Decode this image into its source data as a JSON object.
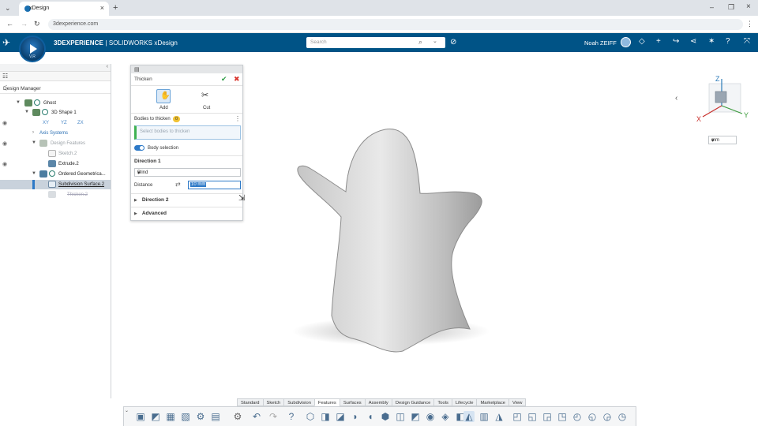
{
  "browser": {
    "tab_title": "xDesign",
    "url": "3dexperience.com"
  },
  "app": {
    "brand_bold": "3DEXPERIENCE",
    "brand_rest": " | SOLIDWORKS xDesign",
    "compass_version": "V,R",
    "search_placeholder": "Search",
    "user_name": "Noah ZEIFF"
  },
  "design_manager": {
    "title": "Design Manager",
    "tree": [
      {
        "label": "Ghost"
      },
      {
        "label": "3D Shape 1"
      },
      {
        "label": "XY",
        "label2": "YZ",
        "label3": "ZX"
      },
      {
        "label": "Axis Systems"
      },
      {
        "label": "Design Features"
      },
      {
        "label": "Sketch.2"
      },
      {
        "label": "Extrude.2"
      },
      {
        "label": "Ordered Geometrica..."
      },
      {
        "label": "Subdivision Surface.2"
      },
      {
        "label": "Thicken.2"
      }
    ]
  },
  "thicken": {
    "title": "Thicken",
    "add_label": "Add",
    "cut_label": "Cut",
    "bodies_label": "Bodies to thicken",
    "bodies_count": "0",
    "bodies_placeholder": "Select bodies to thicken",
    "body_selection_label": "Body selection",
    "direction1_label": "Direction 1",
    "end_condition": "Blind",
    "distance_label": "Distance",
    "distance_value": "10 mm",
    "direction2_label": "Direction 2",
    "advanced_label": "Advanced"
  },
  "viewport": {
    "units": "mm",
    "axis_x": "X",
    "axis_y": "Y",
    "axis_z": "Z"
  },
  "command_tabs": [
    "Standard",
    "Sketch",
    "Subdivision",
    "Features",
    "Surfaces",
    "Assembly",
    "Design Guidance",
    "Tools",
    "Lifecycle",
    "Marketplace",
    "View"
  ],
  "active_command_tab": "Features"
}
